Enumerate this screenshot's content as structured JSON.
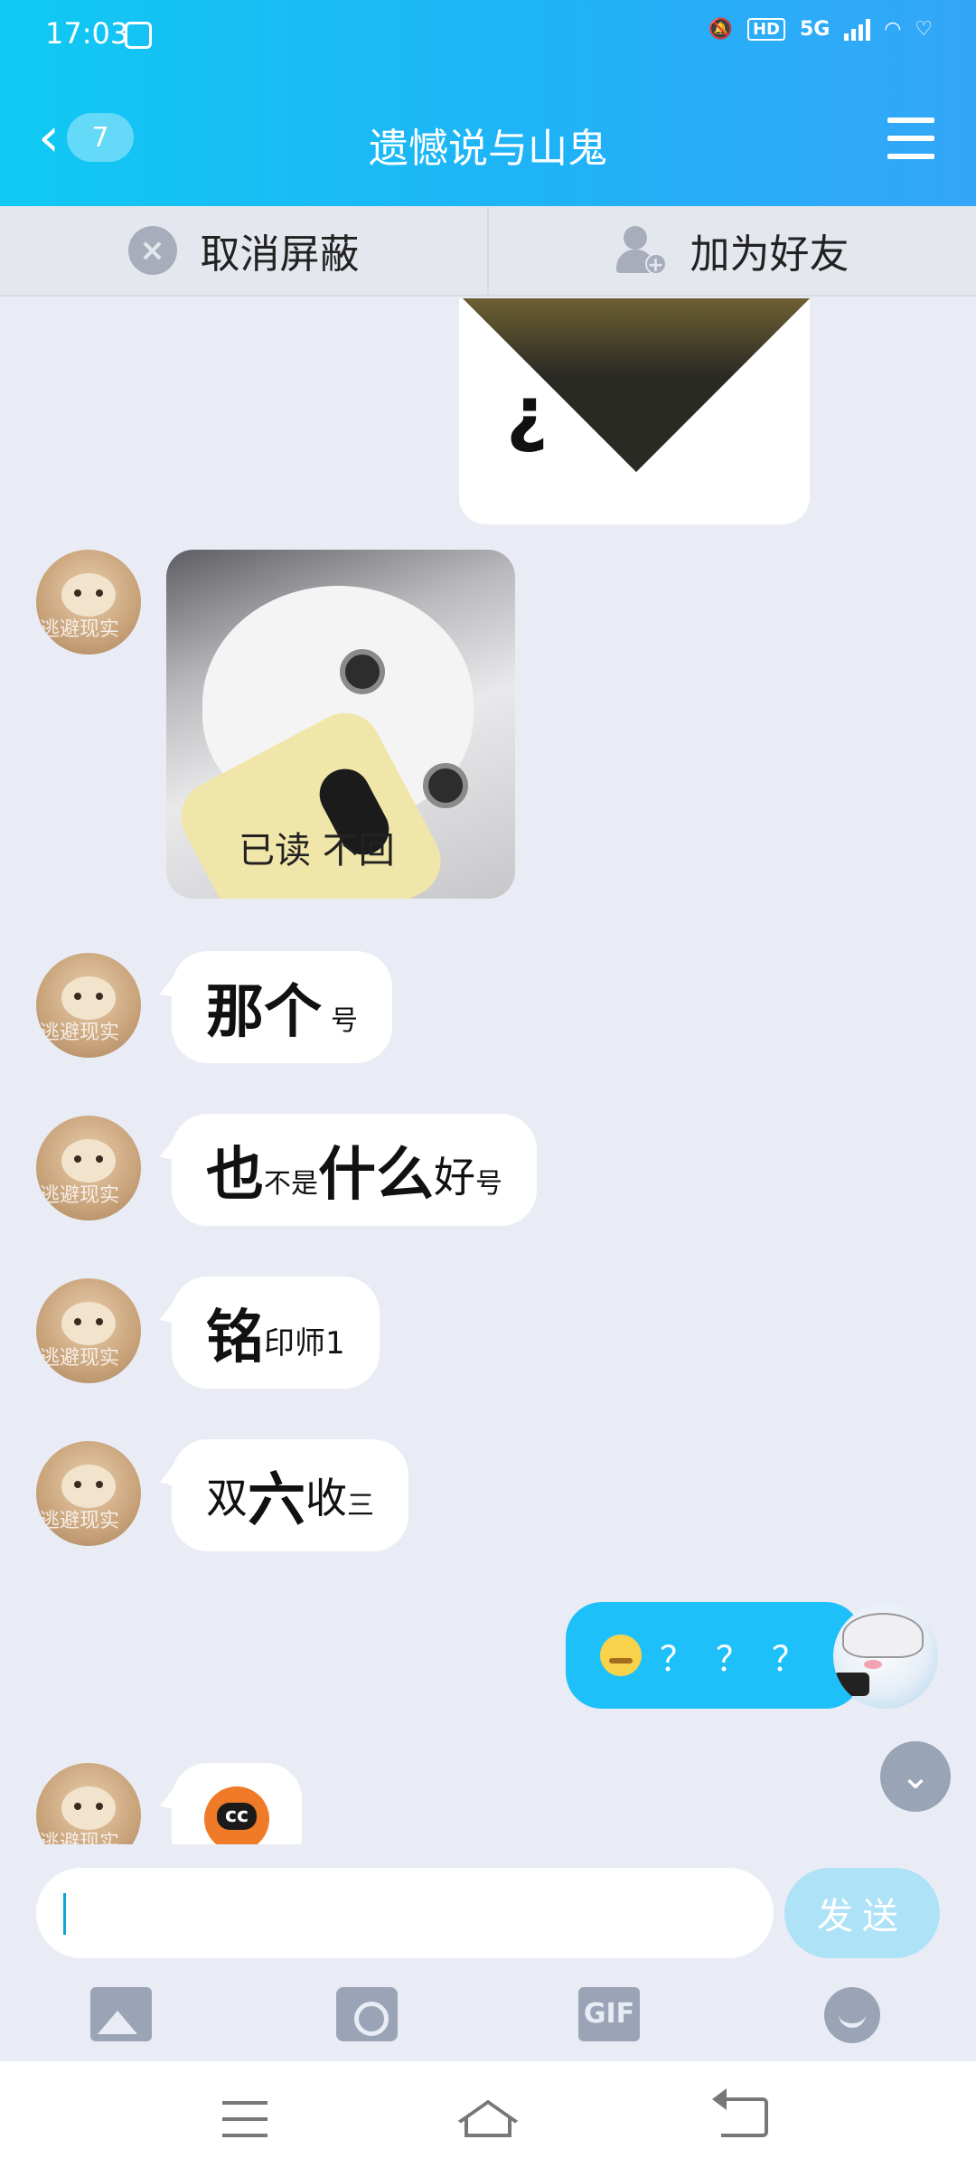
{
  "status": {
    "time": "17:03",
    "network": "5G",
    "hd": "HD"
  },
  "header": {
    "back_count": "7",
    "title": "遗憾说与山鬼"
  },
  "actions": {
    "unblock": "取消屏蔽",
    "add_friend": "加为好友"
  },
  "messages": [
    {
      "from": "self",
      "type": "sticker",
      "caption": "¿"
    },
    {
      "from": "other",
      "type": "sticker",
      "caption": "已读    不回"
    },
    {
      "from": "other",
      "type": "text",
      "big": "那个",
      "small": "号"
    },
    {
      "from": "other",
      "type": "text",
      "big1": "也",
      "small1": "不是",
      "big2": "什么",
      "mid": "好",
      "small2": "号"
    },
    {
      "from": "other",
      "type": "text",
      "big": "铭",
      "small": "印师1"
    },
    {
      "from": "other",
      "type": "text",
      "big1": "双",
      "big2": "六",
      "mid": "收",
      "small": "三"
    },
    {
      "from": "self",
      "type": "text",
      "text": "？？？",
      "emoji": "squint-smiley"
    },
    {
      "from": "other",
      "type": "emoji",
      "emoji": "tiger-cc-sticker"
    }
  ],
  "avatar_watermark": "逃避现实",
  "input": {
    "value": "",
    "send_label": "发送"
  },
  "tools": [
    "image-icon",
    "camera-icon",
    "gif-icon",
    "emoji-icon"
  ],
  "tool_gif_label": "GIF",
  "colors": {
    "header_start": "#10c9f3",
    "header_end": "#34a6f8",
    "self_bubble": "#1ec0fa",
    "send_disabled": "#aee2f7",
    "chat_bg": "#e9ecf4"
  }
}
